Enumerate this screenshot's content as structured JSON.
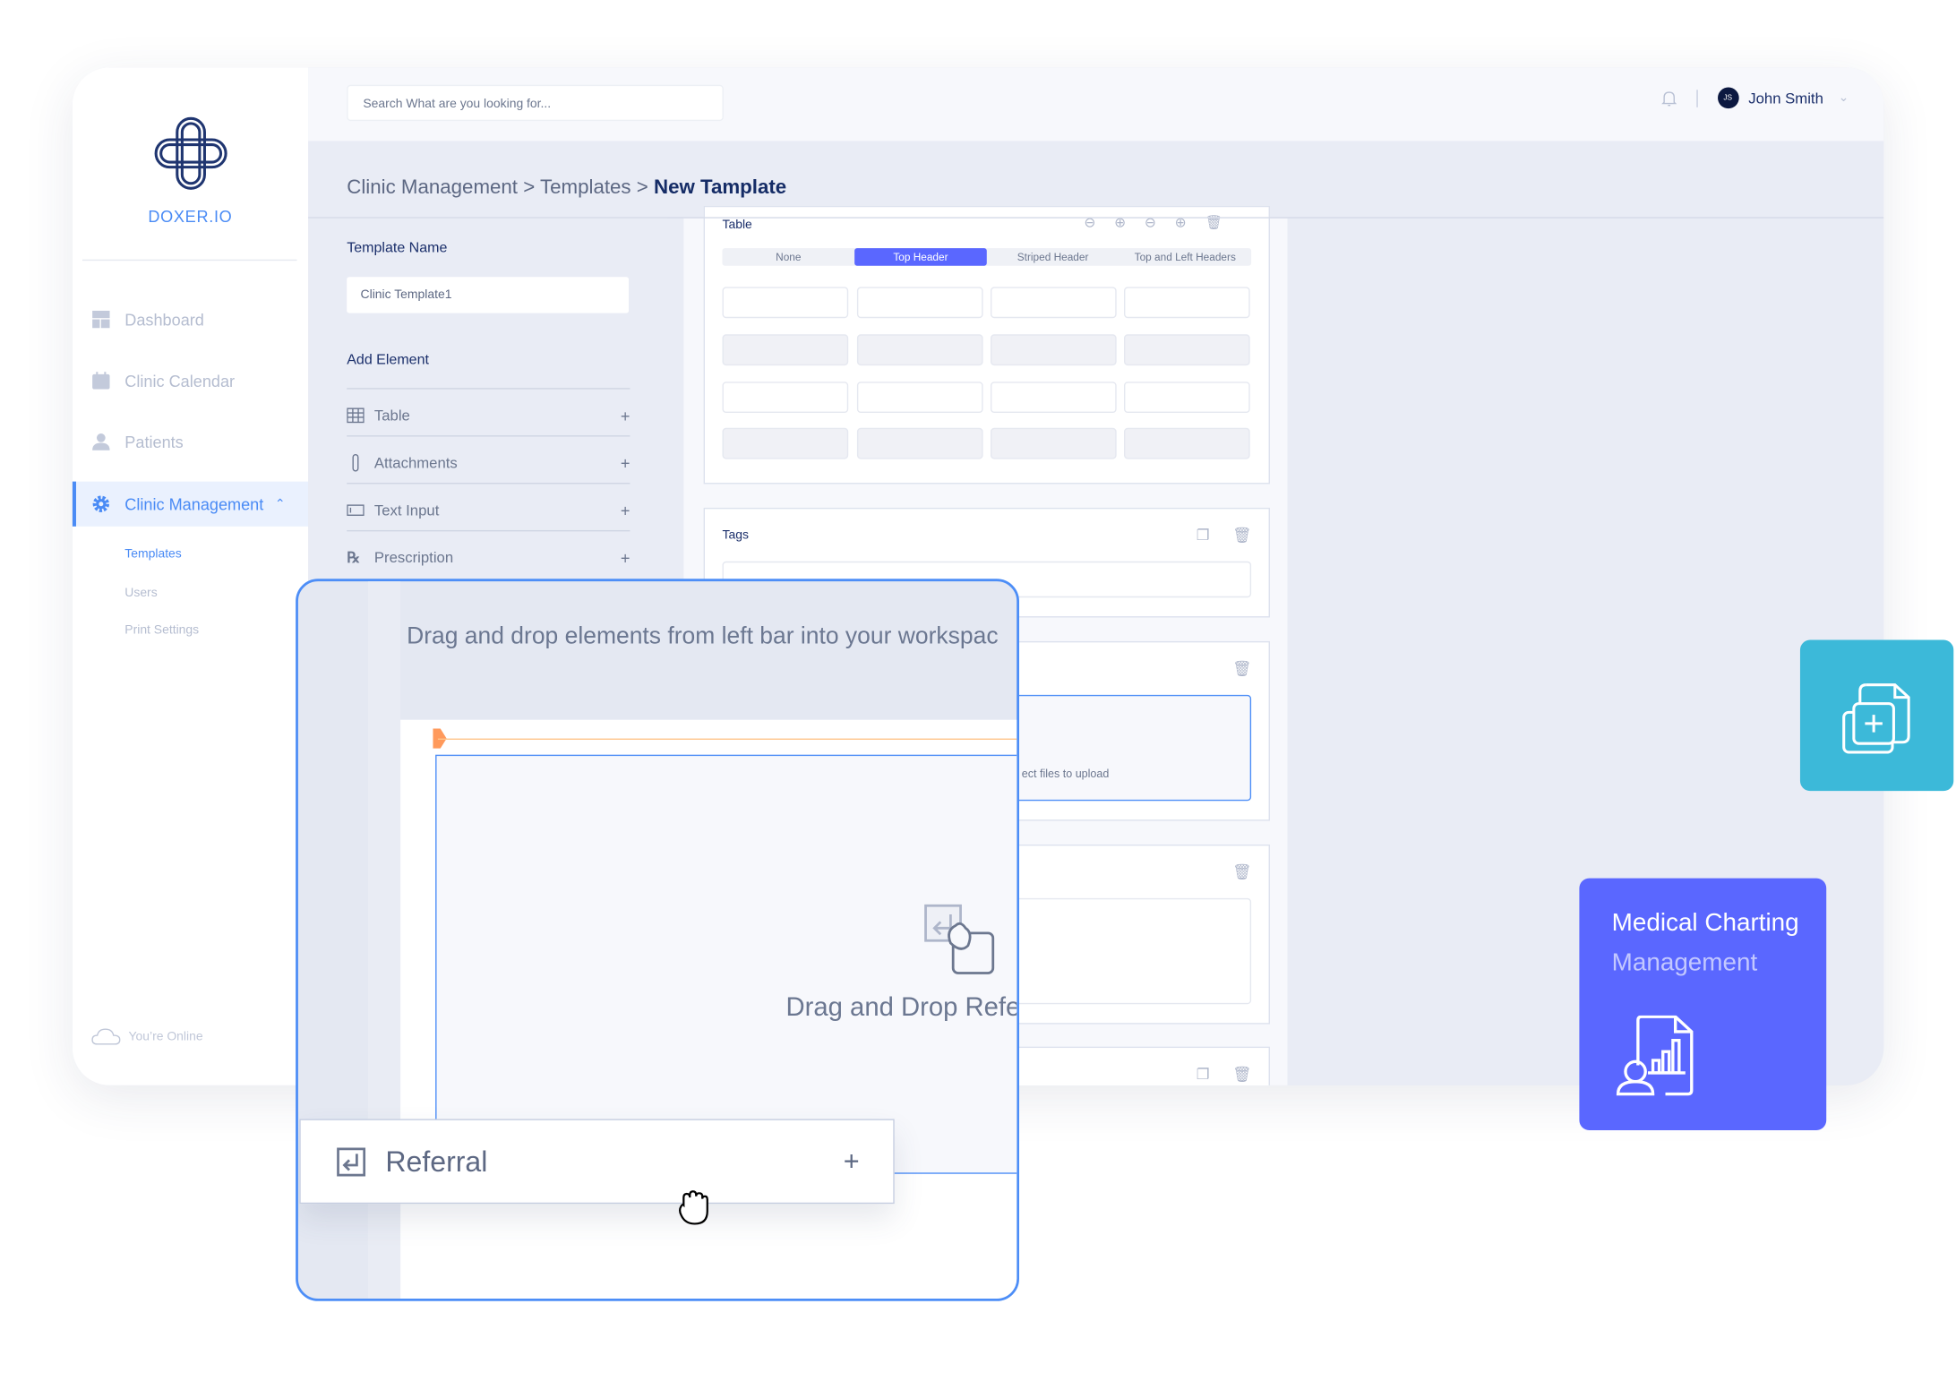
{
  "brand": {
    "name": "DOXER.IO"
  },
  "sidebar": {
    "items": [
      {
        "label": "Dashboard",
        "icon": "dashboard-icon"
      },
      {
        "label": "Clinic Calendar",
        "icon": "calendar-icon"
      },
      {
        "label": "Patients",
        "icon": "user-icon"
      },
      {
        "label": "Clinic Management",
        "icon": "gear-icon",
        "active": true
      }
    ],
    "subitems": [
      {
        "label": "Templates",
        "active": true
      },
      {
        "label": "Users"
      },
      {
        "label": "Print Settings"
      }
    ],
    "status": "You’re Online"
  },
  "topbar": {
    "search_placeholder": "Search What are you looking for...",
    "user_name": "John Smith",
    "user_initials": "JS"
  },
  "breadcrumb": {
    "part1": "Clinic Management",
    "part2": "Templates",
    "current": "New Tamplate",
    "sep": ">"
  },
  "left_panel": {
    "template_name_label": "Template Name",
    "template_name_value": "Clinic Template1",
    "add_element_label": "Add Element",
    "elements": [
      {
        "label": "Table",
        "icon": "table-icon"
      },
      {
        "label": "Attachments",
        "icon": "paperclip-icon"
      },
      {
        "label": "Text Input",
        "icon": "text-input-icon"
      },
      {
        "label": "Prescription",
        "icon": "prescription-icon"
      }
    ],
    "plus": "+"
  },
  "workspace": {
    "table_card": {
      "title": "Table",
      "styles": [
        "None",
        "Top Header",
        "Striped Header",
        "Top and Left Headers"
      ],
      "selected": "Top Header"
    },
    "tags_card": {
      "title": "Tags"
    },
    "attachment_card": {
      "drop_text": "ect files to upload"
    }
  },
  "overlay": {
    "instruction": "Drag and drop elements from left bar into your workspac",
    "drop_label": "Drag and Drop Refe",
    "dragged_item": {
      "label": "Referral",
      "plus": "+"
    }
  },
  "promo": {
    "title": "Medical Charting",
    "subtitle": "Management"
  },
  "colors": {
    "accent": "#4a8bf5",
    "primary": "#5a67ff",
    "teal": "#3cb9d9",
    "navy": "#152c66",
    "drop_marker": "#ff9a5c"
  }
}
